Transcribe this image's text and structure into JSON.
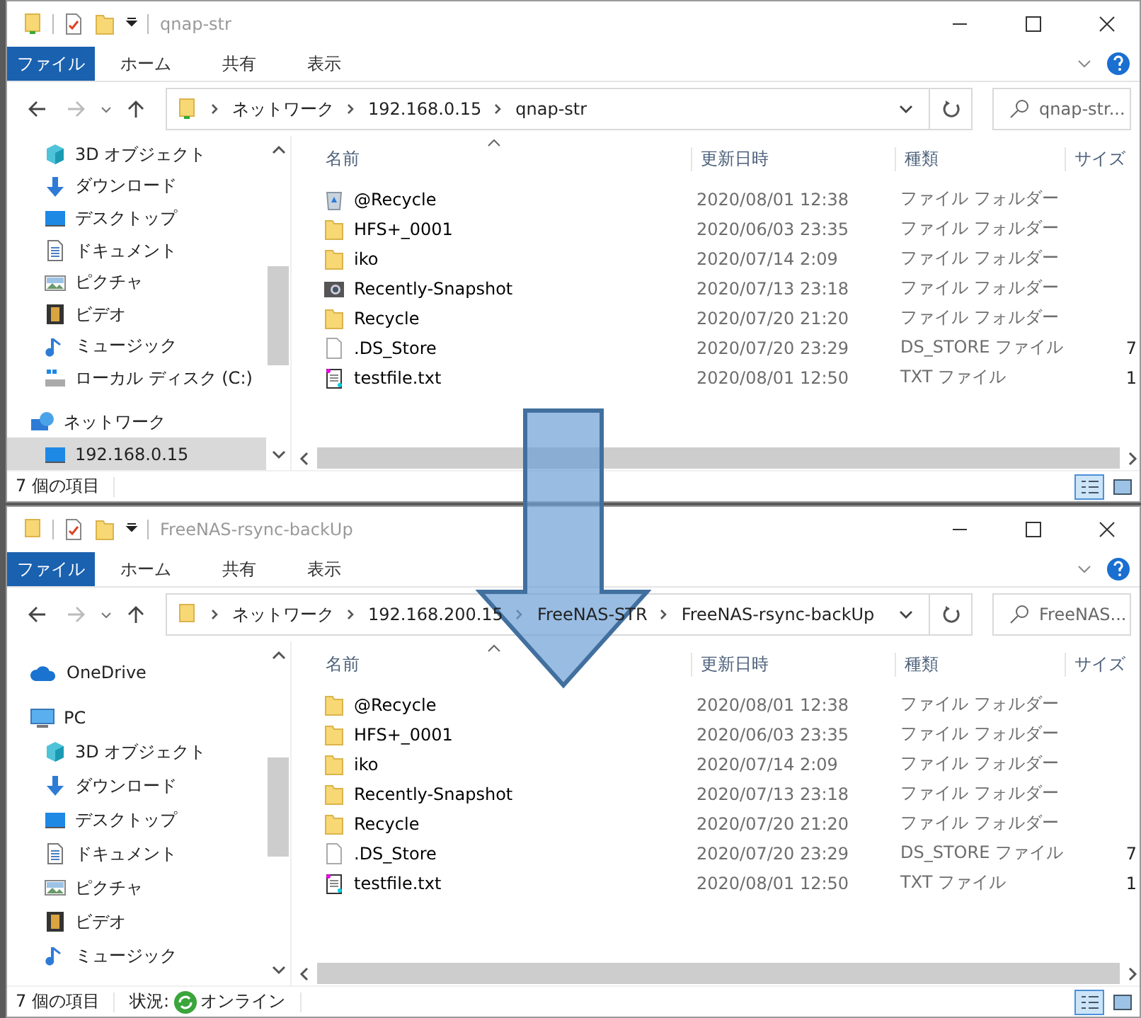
{
  "windows": [
    {
      "title": "qnap-str",
      "ribbon_tabs": [
        {
          "label": "ファイル",
          "selected": true
        },
        {
          "label": "ホーム",
          "selected": false
        },
        {
          "label": "共有",
          "selected": false
        },
        {
          "label": "表示",
          "selected": false
        }
      ],
      "address": {
        "crumbs": [
          "ネットワーク",
          "192.168.0.15",
          "qnap-str"
        ]
      },
      "search": {
        "placeholder": "qnap-str..."
      },
      "sidebar": {
        "items": [
          {
            "kind": "group",
            "children": [
              {
                "label": "3D オブジェクト",
                "kind": "cube",
                "selected": false
              },
              {
                "label": "ダウンロード",
                "kind": "download",
                "selected": false
              },
              {
                "label": "デスクトップ",
                "kind": "desktop",
                "selected": false
              },
              {
                "label": "ドキュメント",
                "kind": "document",
                "selected": false
              },
              {
                "label": "ピクチャ",
                "kind": "picture",
                "selected": false
              },
              {
                "label": "ビデオ",
                "kind": "video",
                "selected": false
              },
              {
                "label": "ミュージック",
                "kind": "music",
                "selected": false
              },
              {
                "label": "ローカル ディスク (C:)",
                "kind": "drive",
                "selected": false
              }
            ]
          },
          {
            "label": "ネットワーク",
            "kind": "network",
            "selected": false,
            "children": [
              {
                "label": "192.168.0.15",
                "kind": "desktop",
                "selected": true
              }
            ]
          }
        ]
      },
      "columns": [
        "名前",
        "更新日時",
        "種類",
        "サイズ"
      ],
      "rows": [
        {
          "kind": "recycle",
          "name": "@Recycle",
          "modified": "2020/08/01 12:38",
          "type": "ファイル フォルダー"
        },
        {
          "kind": "folder",
          "name": "HFS+_0001",
          "modified": "2020/06/03 23:35",
          "type": "ファイル フォルダー"
        },
        {
          "kind": "folder",
          "name": "iko",
          "modified": "2020/07/14 2:09",
          "type": "ファイル フォルダー"
        },
        {
          "kind": "snapshot",
          "name": "Recently-Snapshot",
          "modified": "2020/07/13 23:18",
          "type": "ファイル フォルダー"
        },
        {
          "kind": "folder",
          "name": "Recycle",
          "modified": "2020/07/20 21:20",
          "type": "ファイル フォルダー"
        },
        {
          "kind": "file",
          "name": ".DS_Store",
          "modified": "2020/07/20 23:29",
          "type": "DS_STORE ファイル",
          "size": "7"
        },
        {
          "kind": "text",
          "name": "testfile.txt",
          "modified": "2020/08/01 12:50",
          "type": "TXT ファイル",
          "size": "1"
        }
      ],
      "status_bar": {
        "item_count": "7 個の項目"
      }
    },
    {
      "title": "FreeNAS-rsync-backUp",
      "ribbon_tabs": [
        {
          "label": "ファイル",
          "selected": true
        },
        {
          "label": "ホーム",
          "selected": false
        },
        {
          "label": "共有",
          "selected": false
        },
        {
          "label": "表示",
          "selected": false
        }
      ],
      "address": {
        "crumbs": [
          "ネットワーク",
          "192.168.200.15",
          "FreeNAS-STR",
          "FreeNAS-rsync-backUp"
        ]
      },
      "search": {
        "placeholder": "FreeNAS..."
      },
      "sidebar": {
        "items": [
          {
            "label": "OneDrive",
            "kind": "cloud",
            "selected": false
          },
          {
            "label": "PC",
            "kind": "computer",
            "selected": false,
            "children": [
              {
                "label": "3D オブジェクト",
                "kind": "cube",
                "selected": false
              },
              {
                "label": "ダウンロード",
                "kind": "download",
                "selected": false
              },
              {
                "label": "デスクトップ",
                "kind": "desktop",
                "selected": false
              },
              {
                "label": "ドキュメント",
                "kind": "document",
                "selected": false
              },
              {
                "label": "ピクチャ",
                "kind": "picture",
                "selected": false
              },
              {
                "label": "ビデオ",
                "kind": "video",
                "selected": false
              },
              {
                "label": "ミュージック",
                "kind": "music",
                "selected": false
              }
            ]
          }
        ]
      },
      "columns": [
        "名前",
        "更新日時",
        "種類",
        "サイズ"
      ],
      "rows": [
        {
          "kind": "folder",
          "name": "@Recycle",
          "modified": "2020/08/01 12:38",
          "type": "ファイル フォルダー"
        },
        {
          "kind": "folder",
          "name": "HFS+_0001",
          "modified": "2020/06/03 23:35",
          "type": "ファイル フォルダー"
        },
        {
          "kind": "folder",
          "name": "iko",
          "modified": "2020/07/14 2:09",
          "type": "ファイル フォルダー"
        },
        {
          "kind": "folder",
          "name": "Recently-Snapshot",
          "modified": "2020/07/13 23:18",
          "type": "ファイル フォルダー"
        },
        {
          "kind": "folder",
          "name": "Recycle",
          "modified": "2020/07/20 21:20",
          "type": "ファイル フォルダー"
        },
        {
          "kind": "file",
          "name": ".DS_Store",
          "modified": "2020/07/20 23:29",
          "type": "DS_STORE ファイル",
          "size": "7"
        },
        {
          "kind": "text",
          "name": "testfile.txt",
          "modified": "2020/08/01 12:50",
          "type": "TXT ファイル",
          "size": "1"
        }
      ],
      "status_bar": {
        "item_count": "7 個の項目",
        "state_label": "状況:",
        "state": "オンライン"
      }
    }
  ]
}
